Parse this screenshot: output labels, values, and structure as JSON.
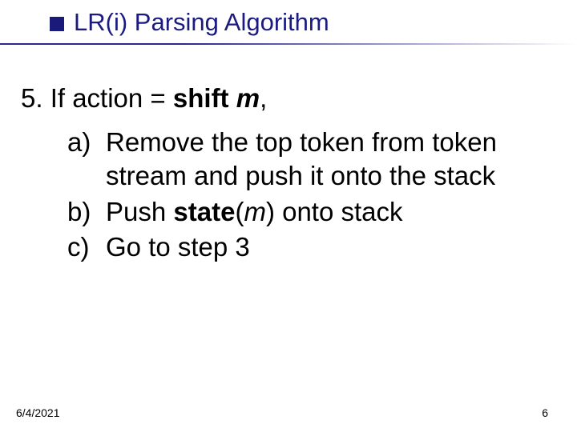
{
  "title": "LR(i) Parsing Algorithm",
  "step": {
    "number": "5.",
    "prefix": "If action = ",
    "action_word": "shift",
    "space": " ",
    "var": "m",
    "suffix": ","
  },
  "subs": {
    "a": {
      "label": "a)",
      "text": "Remove the top token from token stream and push it onto the stack"
    },
    "b": {
      "label": "b)",
      "pre": "Push ",
      "bold": "state",
      "paren_open": "(",
      "var": "m",
      "paren_close": ")",
      "post": " onto stack"
    },
    "c": {
      "label": "c)",
      "text": "Go to step 3"
    }
  },
  "footer": {
    "date": "6/4/2021",
    "page": "6"
  }
}
